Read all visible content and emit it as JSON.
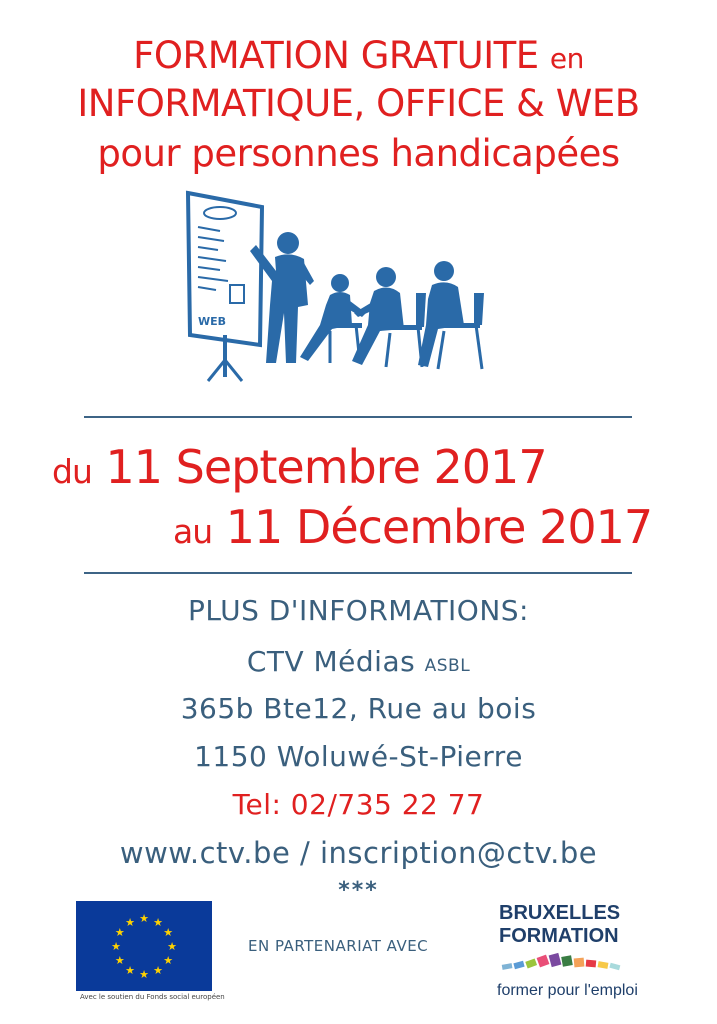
{
  "title": {
    "line1_main": "FORMATION GRATUITE",
    "line1_small": "en",
    "line2": "INFORMATIQUE, OFFICE & WEB",
    "line3": "pour personnes handicapées"
  },
  "illustration": {
    "board_words": [
      "WEB"
    ]
  },
  "dates": {
    "from_prefix": "du",
    "from_date": "11 Septembre 2017",
    "to_prefix": "au",
    "to_date": "11 Décembre 2017"
  },
  "info": {
    "heading": "PLUS D'INFORMATIONS:",
    "org_name": "CTV Médias",
    "org_suffix": "ASBL",
    "address1": "365b Bte12, Rue au bois",
    "address2": "1150 Woluwé-St-Pierre",
    "phone": "Tel: 02/735 22 77",
    "web_email": "www.ctv.be / inscription@ctv.be"
  },
  "separator": "***",
  "partners": {
    "eu_caption": "Avec le soutien du Fonds social européen",
    "partnership_text": "EN PARTENARIAT AVEC",
    "bf_line1": "BRUXELLES",
    "bf_line2": "FORMATION",
    "bf_tagline": "former pour l'emploi"
  },
  "colors": {
    "red": "#e02020",
    "blue": "#3a5f7d",
    "eu_blue": "#0a3a9a",
    "eu_gold": "#ffd200"
  }
}
